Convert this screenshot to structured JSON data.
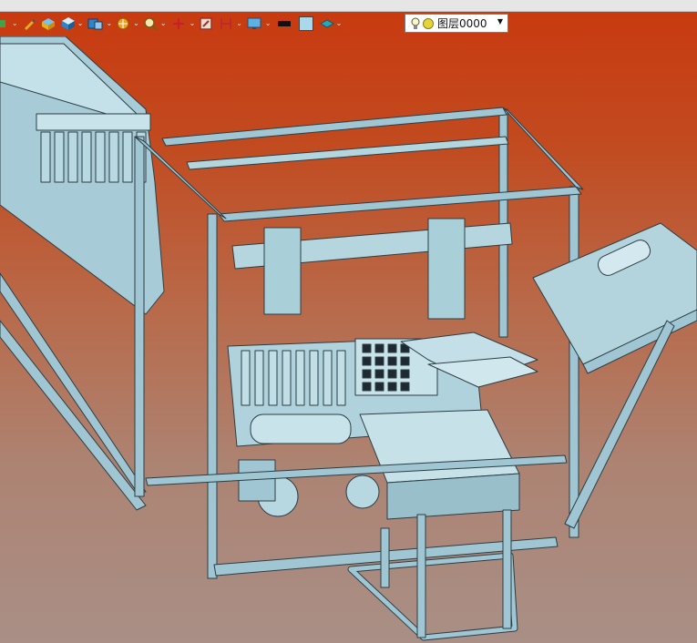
{
  "window": {
    "title": ""
  },
  "toolbar": {
    "items": [
      {
        "name": "pan-icon",
        "has_dropdown": true
      },
      {
        "name": "pencil-icon",
        "has_dropdown": false
      },
      {
        "name": "box-yellow-icon",
        "has_dropdown": false
      },
      {
        "name": "cube-icon",
        "has_dropdown": true
      },
      {
        "name": "view-cube-icon",
        "has_dropdown": true
      },
      {
        "name": "render-style-icon",
        "has_dropdown": true
      },
      {
        "name": "zoom-window-icon",
        "has_dropdown": true
      },
      {
        "name": "triad-icon",
        "has_dropdown": true
      },
      {
        "name": "section-icon",
        "has_dropdown": false
      },
      {
        "name": "hide-show-icon",
        "has_dropdown": true
      },
      {
        "name": "monitor-icon",
        "has_dropdown": true
      },
      {
        "name": "line-color-icon",
        "has_dropdown": false
      },
      {
        "name": "fill-color-icon",
        "has_dropdown": false
      },
      {
        "name": "layer-style-icon",
        "has_dropdown": true
      }
    ],
    "colors": {
      "line": "#111111",
      "fill": "#a8d8ea"
    },
    "layer_select": {
      "value": "图层0000"
    }
  },
  "viewport": {
    "background": {
      "top": "#c9390f",
      "bottom": "#a98f86"
    },
    "model": {
      "color": "#9fc6d2",
      "edge": "#2c3d44"
    }
  }
}
